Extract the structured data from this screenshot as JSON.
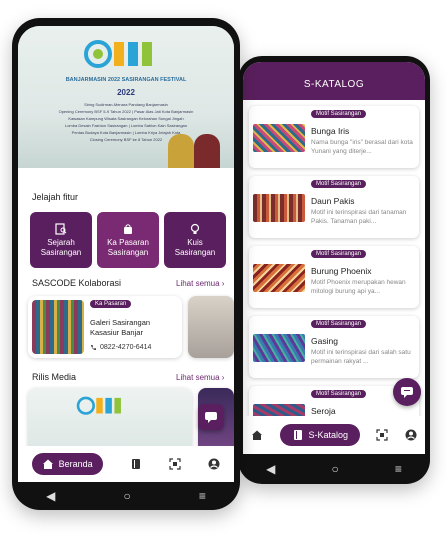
{
  "phone1": {
    "banner": {
      "event_title": "BANJARMASIN 2022 SASIRANGAN FESTIVAL",
      "date_text": "2022",
      "schedule_lines": [
        "Siring Sudirman-Menara Pandang Banjarmasin",
        "Opening Ceremony BSF 5-9 Tahun 2022 | Pasar Alas Jati Kota Banjarmasin",
        "Kawasan Kampung Wisata Sasirangan Kelurahan Sungai Jingah",
        "Lomba Desain Fashion Sasirangan | Lomba Sablon Kain Sasirangan",
        "Pentas Budaya Kota Banjarmasin | Lomba Kriya Jelajah Kota",
        "Closing Ceremony BSF ke 8 Tahun 2022"
      ]
    },
    "jelajah": {
      "title": "Jelajah fitur",
      "items": [
        {
          "label": "Sejarah Sasirangan",
          "icon": "book-search-icon"
        },
        {
          "label": "Ka Pasaran Sasirangan",
          "icon": "shopping-bag-icon"
        },
        {
          "label": "Kuis Sasirangan",
          "icon": "lightbulb-icon"
        }
      ]
    },
    "sascode": {
      "title": "SASCODE Kolaborasi",
      "see_all": "Lihat semua ›",
      "card": {
        "badge": "Ka Pasaran",
        "name_line1": "Galeri Sasirangan",
        "name_line2": "Kasasiur Banjar",
        "phone": "0822-4270-6414"
      }
    },
    "rilis": {
      "title": "Rilis Media",
      "see_all": "Lihat semua ›"
    },
    "nav": {
      "home_label": "Beranda"
    }
  },
  "phone2": {
    "header_title": "S-KATALOG",
    "items": [
      {
        "badge": "Motif Sasirangan",
        "title": "Bunga Iris",
        "desc": "Nama bunga \"iris\" berasal dari kota Yunani yang diterje..."
      },
      {
        "badge": "Motif Sasirangan",
        "title": "Daun Pakis",
        "desc": "Motif ini terinspirasi dari tanaman Pakis. Tanaman paki..."
      },
      {
        "badge": "Motif Sasirangan",
        "title": "Burung Phoenix",
        "desc": "Motif Phoenix merupakan hewan mitologi burung api ya..."
      },
      {
        "badge": "Motif Sasirangan",
        "title": "Gasing",
        "desc": "Motif ini terinspirasi dari salah satu permainan rakyat ..."
      },
      {
        "badge": "Motif Sasirangan",
        "title": "Seroja",
        "desc": ""
      }
    ],
    "nav": {
      "katalog_label": "S-Katalog"
    }
  },
  "colors": {
    "primary": "#5a1f5e",
    "accent": "#6d2a6f"
  }
}
